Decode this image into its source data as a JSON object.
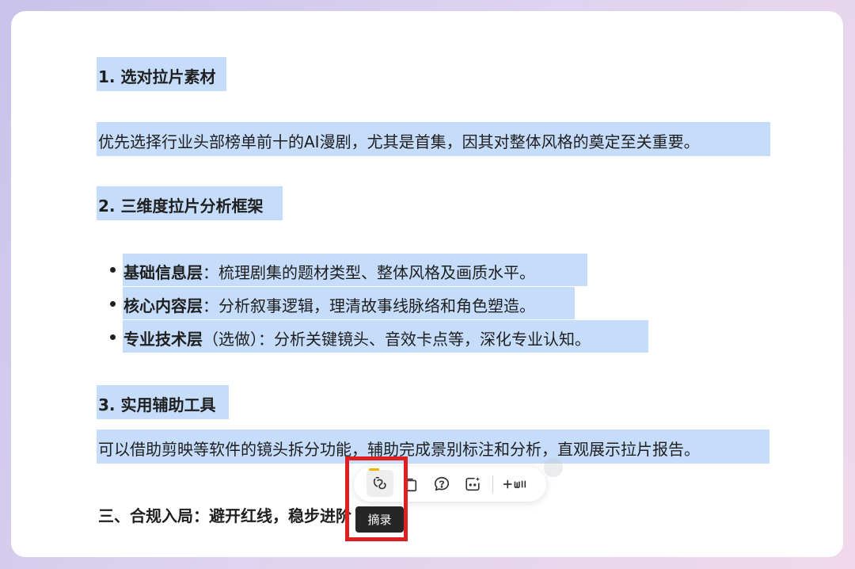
{
  "doc": {
    "section1_heading": "1. 选对拉片素材",
    "section1_body": "优先选择行业头部榜单前十的AI漫剧，尤其是首集，因其对整体风格的奠定至关重要。",
    "section2_heading": "2. 三维度拉片分析框架",
    "bullets": [
      {
        "term": "基础信息层",
        "rest": "：梳理剧集的题材类型、整体风格及画质水平。"
      },
      {
        "term": "核心内容层",
        "rest": "：分析叙事逻辑，理清故事线脉络和角色塑造。"
      },
      {
        "term": "专业技术层",
        "rest": "（选做）：分析关键镜头、音效卡点等，深化专业认知。"
      }
    ],
    "section3_heading": "3. 实用辅助工具",
    "section3_body": "可以借助剪映等软件的镜头拆分功能，辅助完成景别标注和分析，直观展示拉片报告。",
    "next_heading": "三、合规入局：避开红线，稳步进阶"
  },
  "toolbar": {
    "buttons": [
      "excerpt-icon",
      "copy-icon",
      "comment-icon",
      "ai-assistant-icon",
      "add-more-icon"
    ],
    "tooltip": "摘录"
  },
  "colors": {
    "selection_highlight": "#c5dcfa",
    "annotation_box": "#e02020",
    "tooltip_bg": "#262626"
  }
}
